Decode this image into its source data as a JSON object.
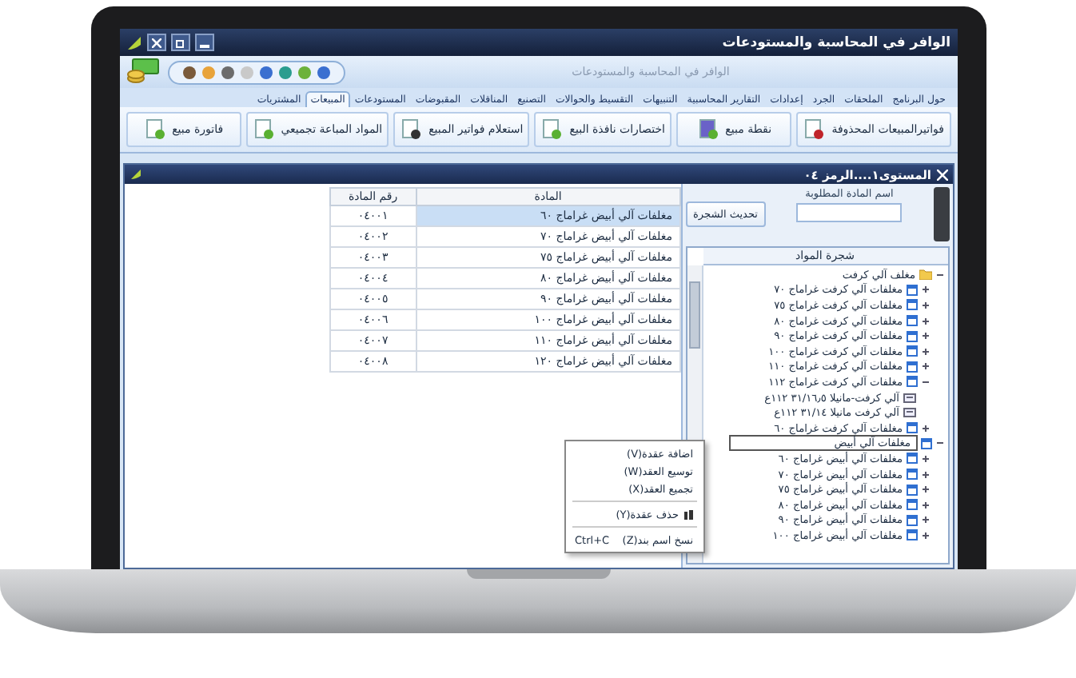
{
  "window": {
    "title": "الوافر في المحاسبة والمستودعات"
  },
  "ribbon": {
    "app_title": "الوافر في المحاسبة والمستودعات",
    "tabs": [
      {
        "label": "حول البرنامج",
        "selected": false
      },
      {
        "label": "الملحقات",
        "selected": false
      },
      {
        "label": "الجرد",
        "selected": false
      },
      {
        "label": "إعدادات",
        "selected": false
      },
      {
        "label": "التقارير المحاسبية",
        "selected": false
      },
      {
        "label": "التنبيهات",
        "selected": false
      },
      {
        "label": "التقسيط والحوالات",
        "selected": false
      },
      {
        "label": "التصنيع",
        "selected": false
      },
      {
        "label": "المناقلات",
        "selected": false
      },
      {
        "label": "المقبوضات",
        "selected": false
      },
      {
        "label": "المستودعات",
        "selected": false
      },
      {
        "label": "المبيعات",
        "selected": true
      },
      {
        "label": "المشتريات",
        "selected": false
      }
    ],
    "buttons": [
      {
        "label": "فواتيرالمبيعات المحذوفة",
        "kind": "deleted"
      },
      {
        "label": "نقطة مبيع",
        "kind": "pos"
      },
      {
        "label": "اختصارات نافذة البيع",
        "kind": "grid"
      },
      {
        "label": "استعلام فواتير المبيع",
        "kind": "query"
      },
      {
        "label": "المواد المباعة تجميعي",
        "kind": "doc"
      },
      {
        "label": "فاتورة مبيع",
        "kind": "doc"
      }
    ]
  },
  "child_window": {
    "title": "المستوى١....الرمز ٠٤"
  },
  "table": {
    "columns": [
      "المادة",
      "رقم المادة"
    ],
    "rows": [
      {
        "material": "مغلفات آلي أبيض غراماج ٦٠",
        "number": "٠٤٠٠١",
        "selected": true
      },
      {
        "material": "مغلفات آلي أبيض غراماج ٧٠",
        "number": "٠٤٠٠٢",
        "selected": false
      },
      {
        "material": "مغلفات آلي أبيض غراماج ٧٥",
        "number": "٠٤٠٠٣",
        "selected": false
      },
      {
        "material": "مغلفات آلي أبيض غراماج ٨٠",
        "number": "٠٤٠٠٤",
        "selected": false
      },
      {
        "material": "مغلفات آلي أبيض غراماج ٩٠",
        "number": "٠٤٠٠٥",
        "selected": false
      },
      {
        "material": "مغلفات آلي أبيض غراماج ١٠٠",
        "number": "٠٤٠٠٦",
        "selected": false
      },
      {
        "material": "مغلفات آلي أبيض غراماج ١١٠",
        "number": "٠٤٠٠٧",
        "selected": false
      },
      {
        "material": "مغلفات آلي أبيض غراماج ١٢٠",
        "number": "٠٤٠٠٨",
        "selected": false
      }
    ]
  },
  "search": {
    "label": "اسم المادة المطلوبة",
    "button": "تحديث الشجرة"
  },
  "tree": {
    "title": "شجرة المواد",
    "nodes": [
      {
        "label": "مغلف آلي كرفت",
        "kind": "folder",
        "expanded": true,
        "children": [
          {
            "label": "مغلفات آلي كرفت غراماج ٧٠",
            "kind": "group",
            "expanded": false
          },
          {
            "label": "مغلفات آلي كرفت غراماج ٧٥",
            "kind": "group",
            "expanded": false
          },
          {
            "label": "مغلفات آلي كرفت غراماج ٨٠",
            "kind": "group",
            "expanded": false
          },
          {
            "label": "مغلفات آلي كرفت غراماج ٩٠",
            "kind": "group",
            "expanded": false
          },
          {
            "label": "مغلفات آلي كرفت غراماج ١٠٠",
            "kind": "group",
            "expanded": false
          },
          {
            "label": "مغلفات آلي كرفت غراماج ١١٠",
            "kind": "group",
            "expanded": false
          },
          {
            "label": "مغلفات آلي كرفت غراماج ١١٢",
            "kind": "group",
            "expanded": true,
            "children": [
              {
                "label": "آلي كرفت-مانيلا ٣١/١٦٫٥ ١١٢ع",
                "kind": "item"
              },
              {
                "label": "آلي كرفت مانيلا ٣١/١٤ ١١٢ع",
                "kind": "item"
              }
            ]
          },
          {
            "label": "مغلفات آلي كرفت غراماج ٦٠",
            "kind": "group",
            "expanded": false
          }
        ]
      },
      {
        "label": "مغلفات آلي أبيض",
        "kind": "editing",
        "expanded": true,
        "children": [
          {
            "label": "مغلفات آلي أبيض غراماج ٦٠",
            "kind": "group",
            "expanded": false
          },
          {
            "label": "مغلفات آلي أبيض غراماج ٧٠",
            "kind": "group",
            "expanded": false
          },
          {
            "label": "مغلفات آلي أبيض غراماج ٧٥",
            "kind": "group",
            "expanded": false
          },
          {
            "label": "مغلفات آلي أبيض غراماج ٨٠",
            "kind": "group",
            "expanded": false
          },
          {
            "label": "مغلفات آلي أبيض غراماج ٩٠",
            "kind": "group",
            "expanded": false
          },
          {
            "label": "مغلفات آلي أبيض غراماج ١٠٠",
            "kind": "group",
            "expanded": false
          }
        ]
      }
    ]
  },
  "context_menu": {
    "groups": [
      [
        {
          "label": "اضافة عقدة(V)"
        },
        {
          "label": "توسيع العقد(W)"
        },
        {
          "label": "تجميع العقد(X)"
        }
      ],
      [
        {
          "label": "حذف عقدة(Y)",
          "icon": true
        }
      ],
      [
        {
          "label": "نسخ اسم بند(Z)",
          "shortcut": "Ctrl+C"
        }
      ]
    ]
  }
}
